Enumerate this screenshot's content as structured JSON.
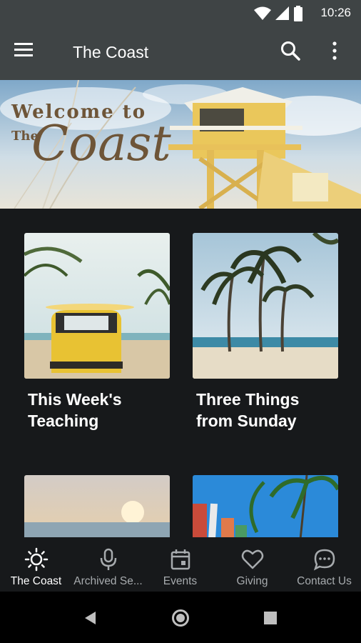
{
  "status_bar": {
    "time": "10:26"
  },
  "app_bar": {
    "title": "The Coast"
  },
  "hero": {
    "line1": "Welcome to",
    "line2": "The",
    "line3": "Coast"
  },
  "cards": [
    {
      "label": "This Week's Teaching"
    },
    {
      "label": "Three Things from Sunday"
    }
  ],
  "bottom_nav": {
    "items": [
      {
        "label": "The Coast",
        "icon": "sun-icon",
        "active": true
      },
      {
        "label": "Archived Se...",
        "icon": "microphone-icon"
      },
      {
        "label": "Events",
        "icon": "calendar-icon"
      },
      {
        "label": "Giving",
        "icon": "heart-icon"
      },
      {
        "label": "Contact Us",
        "icon": "chat-bubble-icon"
      }
    ]
  },
  "colors": {
    "app_bar": "#3f4445",
    "background": "#17191b",
    "inactive_nav": "#a7abae"
  }
}
